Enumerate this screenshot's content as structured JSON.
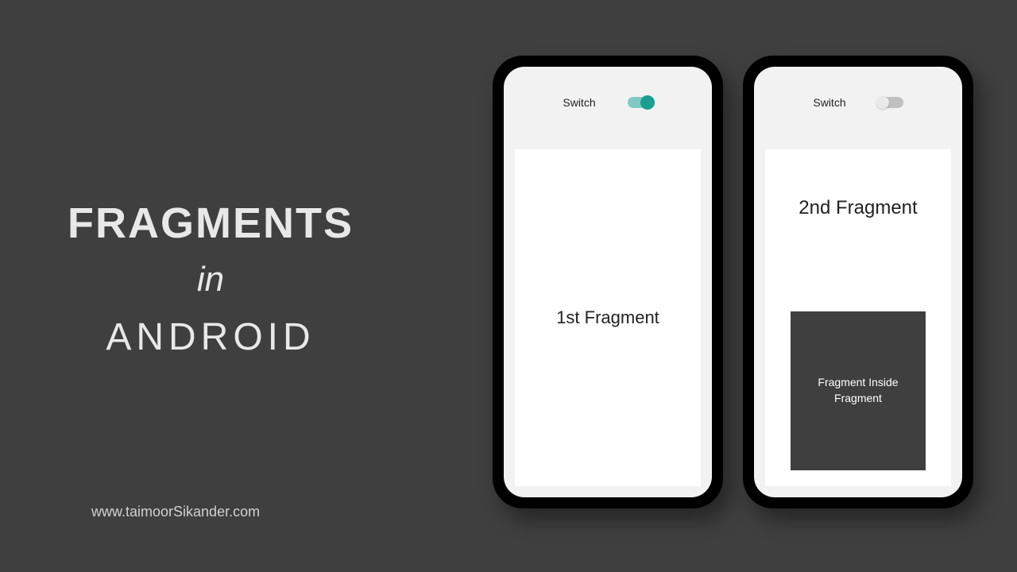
{
  "title": {
    "line1": "FRAGMENTS",
    "line2": "in",
    "line3": "ANDROID"
  },
  "footer_url": "www.taimoorSikander.com",
  "phone1": {
    "switch_label": "Switch",
    "switch_on": true,
    "fragment_text": "1st Fragment"
  },
  "phone2": {
    "switch_label": "Switch",
    "switch_on": false,
    "fragment_text": "2nd Fragment",
    "nested_text": "Fragment Inside Fragment"
  }
}
